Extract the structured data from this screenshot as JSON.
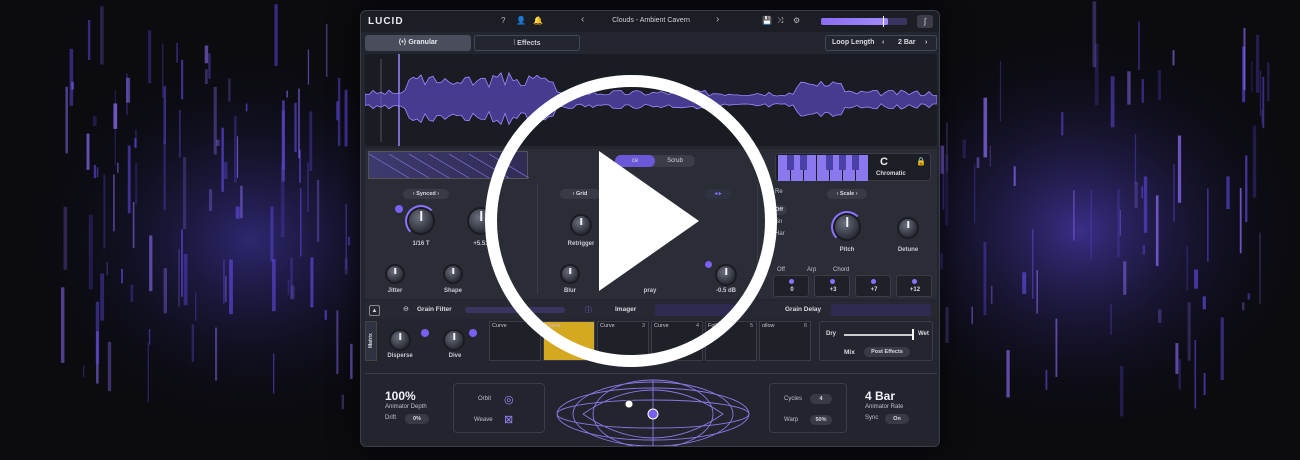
{
  "app": {
    "logo": "LUCID"
  },
  "header": {
    "preset_name": "Clouds - Ambient Cavern",
    "prev_arrow": "‹",
    "next_arrow": "›"
  },
  "tabs": {
    "granular": "Granular",
    "effects": "Effects"
  },
  "loop": {
    "label": "Loop Length",
    "value": "2 Bar"
  },
  "sections": {
    "timing": {
      "mode": "Synced",
      "knobs": [
        {
          "label": "1/16 T"
        },
        {
          "label": "+5.51"
        },
        {
          "label": "Jitter"
        },
        {
          "label": "Shape"
        }
      ]
    },
    "grid": {
      "toggle_left": "ce",
      "toggle_right": "Scrub",
      "mode": "Grid",
      "knobs": [
        {
          "label": "Retrigger"
        },
        {
          "label": "Blur"
        },
        {
          "label": "pray"
        },
        {
          "label": "-0.5 dB"
        }
      ]
    },
    "pitch": {
      "key": "C",
      "scale_name": "Chromatic",
      "scale_pill": "Scale",
      "knobs": [
        {
          "label": "Pitch"
        },
        {
          "label": "Detune"
        }
      ],
      "options": [
        "Off",
        "Arp",
        "Chord"
      ],
      "side_labels": [
        "Re",
        "Off",
        "Sn",
        "Har"
      ],
      "intervals": [
        "0",
        "+3",
        "+7",
        "+12"
      ]
    }
  },
  "filter_row": {
    "grain_filter": "Grain Filter",
    "imager": "Imager",
    "grain_delay": "Grain Delay"
  },
  "matrix": {
    "label": "Matrix",
    "knobs": [
      {
        "label": "Disperse"
      },
      {
        "label": "Dive"
      }
    ],
    "slots": [
      {
        "name": "Curve",
        "num": "1"
      },
      {
        "name": "Curve",
        "num": "2"
      },
      {
        "name": "Curve",
        "num": "3"
      },
      {
        "name": "Curve",
        "num": "4"
      },
      {
        "name": "Follow",
        "num": "5"
      },
      {
        "name": "ollow",
        "num": "6"
      }
    ],
    "mix": {
      "dry": "Dry",
      "wet": "Wet",
      "label": "Mix",
      "mode": "Post Effects"
    }
  },
  "animator": {
    "depth_value": "100%",
    "depth_label": "Animator Depth",
    "drift_label": "Drift",
    "drift_value": "0%",
    "orbit_label": "Orbit",
    "weave_label": "Weave",
    "cycles_label": "Cycles",
    "cycles_value": "4",
    "warp_label": "Warp",
    "warp_value": "50%",
    "rate_value": "4 Bar",
    "rate_label": "Animator Rate",
    "sync_label": "Sync",
    "sync_value": "On"
  },
  "colors": {
    "accent": "#8a72ff",
    "panel": "#23262e",
    "background": "#0b0b10"
  },
  "icons": [
    "question-icon",
    "user-icon",
    "bell-icon",
    "save-icon",
    "shuffle-icon",
    "gear-icon",
    "curve-icon",
    "play-icon"
  ]
}
